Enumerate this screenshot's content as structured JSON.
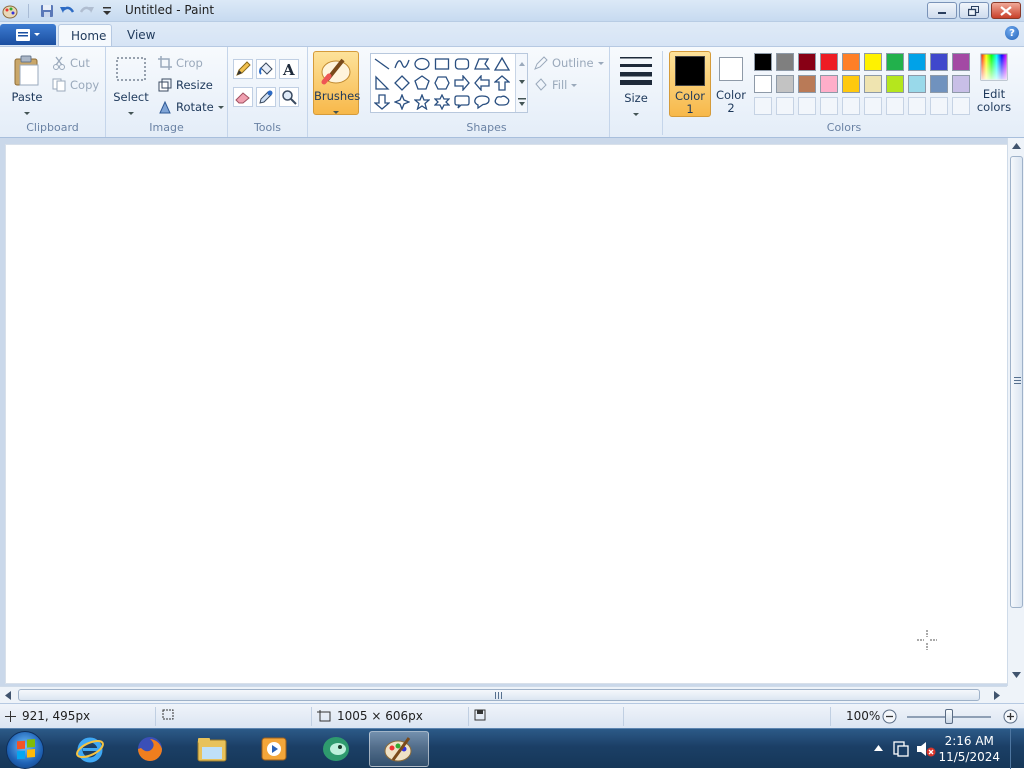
{
  "window": {
    "title": "Untitled - Paint"
  },
  "tabs": {
    "home": "Home",
    "view": "View"
  },
  "clipboard": {
    "paste": "Paste",
    "cut": "Cut",
    "copy": "Copy",
    "group": "Clipboard"
  },
  "image": {
    "select": "Select",
    "crop": "Crop",
    "resize": "Resize",
    "rotate": "Rotate",
    "group": "Image"
  },
  "tools": {
    "group": "Tools"
  },
  "brushes": {
    "label": "Brushes"
  },
  "shapes": {
    "outline": "Outline",
    "fill": "Fill",
    "group": "Shapes"
  },
  "size": {
    "label": "Size"
  },
  "colors": {
    "color1_line1": "Color",
    "color1_line2": "1",
    "color2_line1": "Color",
    "color2_line2": "2",
    "edit_line1": "Edit",
    "edit_line2": "colors",
    "group": "Colors",
    "color1": "#000000",
    "color2": "#ffffff",
    "palette_row1": [
      "#000000",
      "#7f7f7f",
      "#880015",
      "#ed1c24",
      "#ff7f27",
      "#fff200",
      "#22b14c",
      "#00a2e8",
      "#3f48cc",
      "#a349a4"
    ],
    "palette_row2": [
      "#ffffff",
      "#c3c3c3",
      "#b97a57",
      "#ffaec9",
      "#ffc90e",
      "#efe4b0",
      "#b5e61d",
      "#99d9ea",
      "#7092be",
      "#c8bfe7"
    ]
  },
  "status": {
    "cursor_pos": "921, 495px",
    "canvas_size": "1005 × 606px",
    "zoom": "100%"
  },
  "taskbar": {
    "time": "2:16 AM",
    "date": "11/5/2024"
  }
}
